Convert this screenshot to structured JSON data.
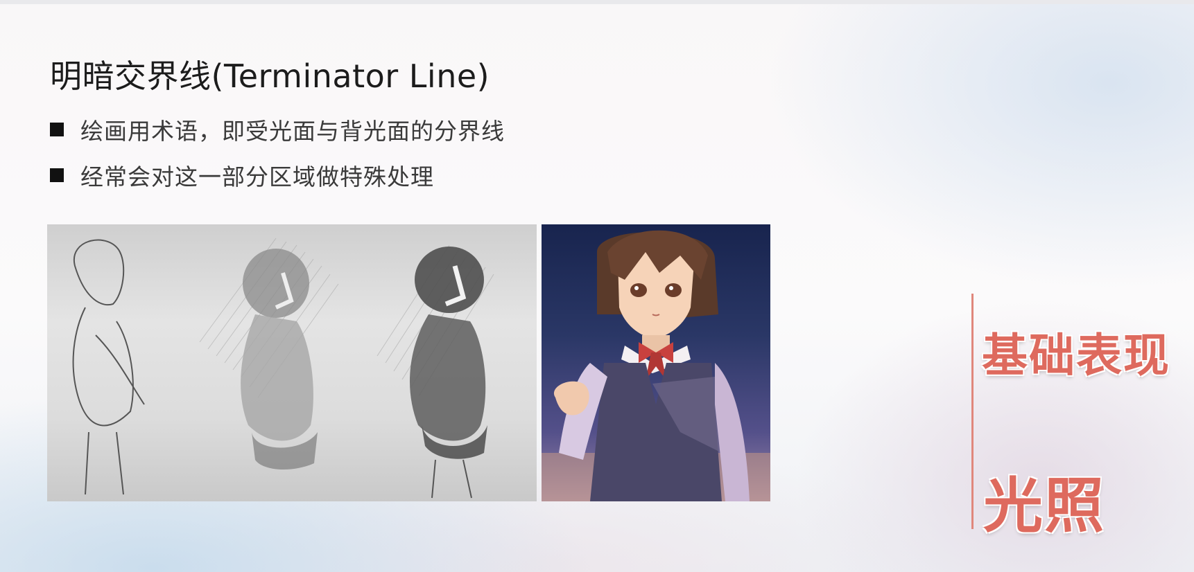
{
  "slide": {
    "title": "明暗交界线(Terminator Line)",
    "bullets": [
      "绘画用术语，即受光面与背光面的分界线",
      "经常会对这一部分区域做特殊处理"
    ],
    "side_label_top": "基础表现",
    "side_label_bottom": "光照",
    "accent_color": "#de6a5e"
  }
}
